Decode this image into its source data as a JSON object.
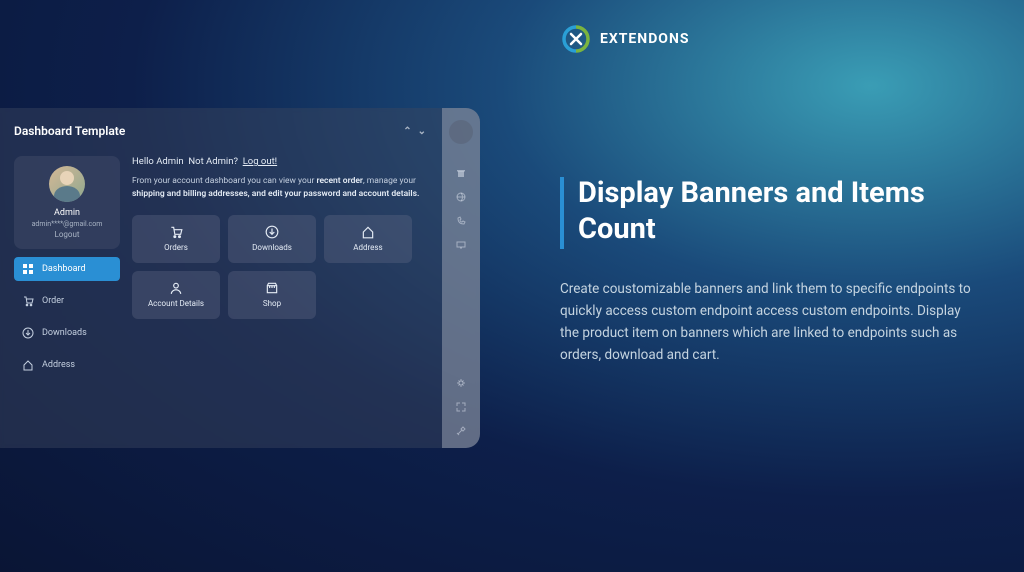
{
  "brand": {
    "name": "EXTENDONS"
  },
  "headline": "Display Banners and Items Count",
  "description": "Create coustomizable banners and link them to specific endpoints to quickly access custom endpoint access custom endpoints. Display the product item on banners which are linked to endpoints such as orders, download and cart.",
  "panel": {
    "title": "Dashboard Template",
    "profile": {
      "name": "Admin",
      "email": "admin****@gmail.com",
      "logout": "Logout"
    },
    "nav": [
      {
        "label": "Dashboard",
        "active": true
      },
      {
        "label": "Order",
        "active": false
      },
      {
        "label": "Downloads",
        "active": false
      },
      {
        "label": "Address",
        "active": false
      }
    ],
    "greeting": {
      "hello": "Hello Admin",
      "notAdmin": "Not Admin?",
      "logout": "Log out!"
    },
    "intro": {
      "p1": "From your account dashboard you can view your",
      "b1": "recent order",
      "p2": ", manage your",
      "b2": "shipping and billing addresses, and edit your password and account details."
    },
    "tiles": [
      {
        "label": "Orders"
      },
      {
        "label": "Downloads"
      },
      {
        "label": "Address"
      },
      {
        "label": "Account Details"
      },
      {
        "label": "Shop"
      }
    ]
  }
}
